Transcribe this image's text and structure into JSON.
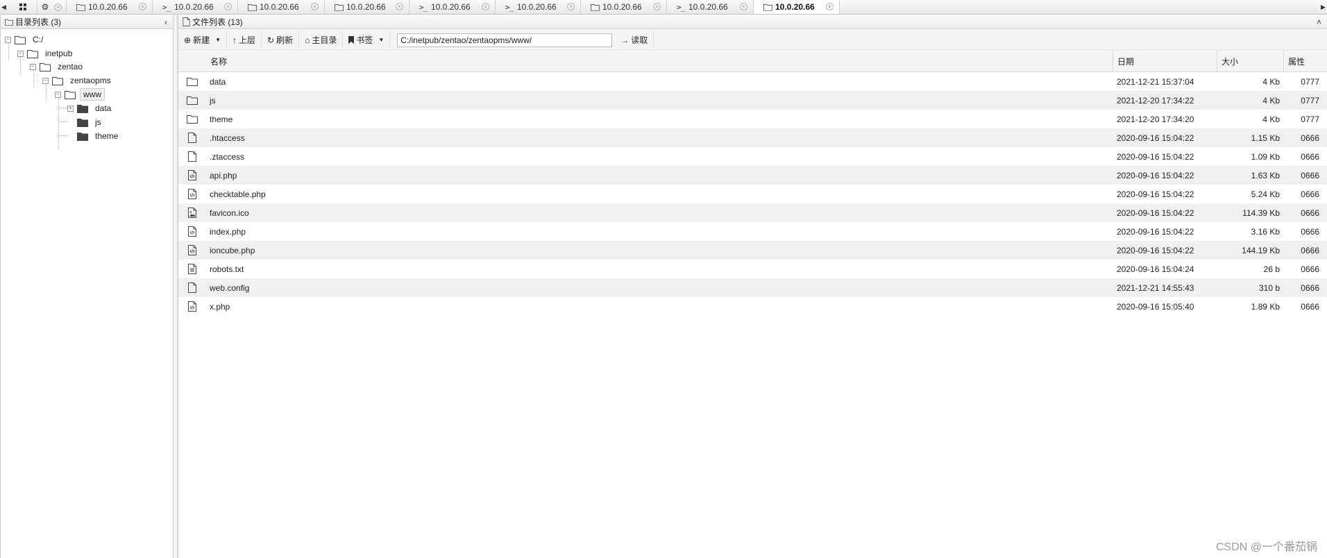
{
  "tabs": [
    {
      "type": "folder",
      "label": "10.0.20.66"
    },
    {
      "type": "terminal",
      "label": "10.0.20.66"
    },
    {
      "type": "folder",
      "label": "10.0.20.66"
    },
    {
      "type": "folder",
      "label": "10.0.20.66"
    },
    {
      "type": "terminal",
      "label": "10.0.20.66"
    },
    {
      "type": "terminal",
      "label": "10.0.20.66"
    },
    {
      "type": "folder",
      "label": "10.0.20.66"
    },
    {
      "type": "terminal",
      "label": "10.0.20.66"
    },
    {
      "type": "folder",
      "label": "10.0.20.66",
      "active": true
    }
  ],
  "terminal_prefix": ">_",
  "dir_panel": {
    "title": "目录列表 (3)",
    "nodes": [
      "C:/",
      "inetpub",
      "zentao",
      "zentaopms",
      "www",
      "data",
      "js",
      "theme"
    ]
  },
  "file_panel": {
    "title": "文件列表 (13)"
  },
  "toolbar": {
    "new": "新建",
    "up": "上层",
    "refresh": "刷新",
    "home": "主目录",
    "bookmark": "书签",
    "path": "C:/inetpub/zentao/zentaopms/www/",
    "read": "读取"
  },
  "columns": {
    "name": "名称",
    "date": "日期",
    "size": "大小",
    "attr": "属性"
  },
  "files": [
    {
      "icon": "folder-icon",
      "name": "data",
      "date": "2021-12-21 15:37:04",
      "size": "4 Kb",
      "attr": "0777"
    },
    {
      "icon": "folder-icon",
      "name": "js",
      "date": "2021-12-20 17:34:22",
      "size": "4 Kb",
      "attr": "0777"
    },
    {
      "icon": "folder-icon",
      "name": "theme",
      "date": "2021-12-20 17:34:20",
      "size": "4 Kb",
      "attr": "0777"
    },
    {
      "icon": "file-icon",
      "name": ".htaccess",
      "date": "2020-09-16 15:04:22",
      "size": "1.15 Kb",
      "attr": "0666"
    },
    {
      "icon": "file-icon",
      "name": ".ztaccess",
      "date": "2020-09-16 15:04:22",
      "size": "1.09 Kb",
      "attr": "0666"
    },
    {
      "icon": "code-file-icon",
      "name": "api.php",
      "date": "2020-09-16 15:04:22",
      "size": "1.63 Kb",
      "attr": "0666"
    },
    {
      "icon": "code-file-icon",
      "name": "checktable.php",
      "date": "2020-09-16 15:04:22",
      "size": "5.24 Kb",
      "attr": "0666"
    },
    {
      "icon": "image-file-icon",
      "name": "favicon.ico",
      "date": "2020-09-16 15:04:22",
      "size": "114.39 Kb",
      "attr": "0666"
    },
    {
      "icon": "code-file-icon",
      "name": "index.php",
      "date": "2020-09-16 15:04:22",
      "size": "3.16 Kb",
      "attr": "0666"
    },
    {
      "icon": "code-file-icon",
      "name": "ioncube.php",
      "date": "2020-09-16 15:04:22",
      "size": "144.19 Kb",
      "attr": "0666"
    },
    {
      "icon": "text-file-icon",
      "name": "robots.txt",
      "date": "2020-09-16 15:04:24",
      "size": "26 b",
      "attr": "0666"
    },
    {
      "icon": "file-icon",
      "name": "web.config",
      "date": "2021-12-21 14:55:43",
      "size": "310 b",
      "attr": "0666"
    },
    {
      "icon": "code-file-icon",
      "name": "x.php",
      "date": "2020-09-16 15:05:40",
      "size": "1.89 Kb",
      "attr": "0666"
    }
  ],
  "watermark": "CSDN @一个番茄锅"
}
